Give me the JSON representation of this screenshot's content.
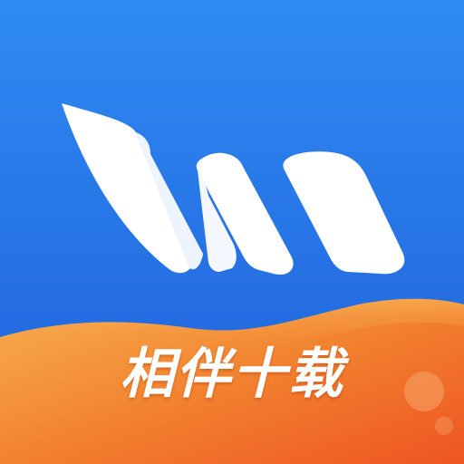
{
  "icon": {
    "name": "app-logo-icon",
    "slogan": "相伴十载"
  },
  "colors": {
    "background_top": "#2F8BF3",
    "background_bottom": "#1F5FD9",
    "wave_top": "#F6A94A",
    "wave_bottom": "#EF5A23",
    "logo_fill": "#FFFFFF"
  }
}
